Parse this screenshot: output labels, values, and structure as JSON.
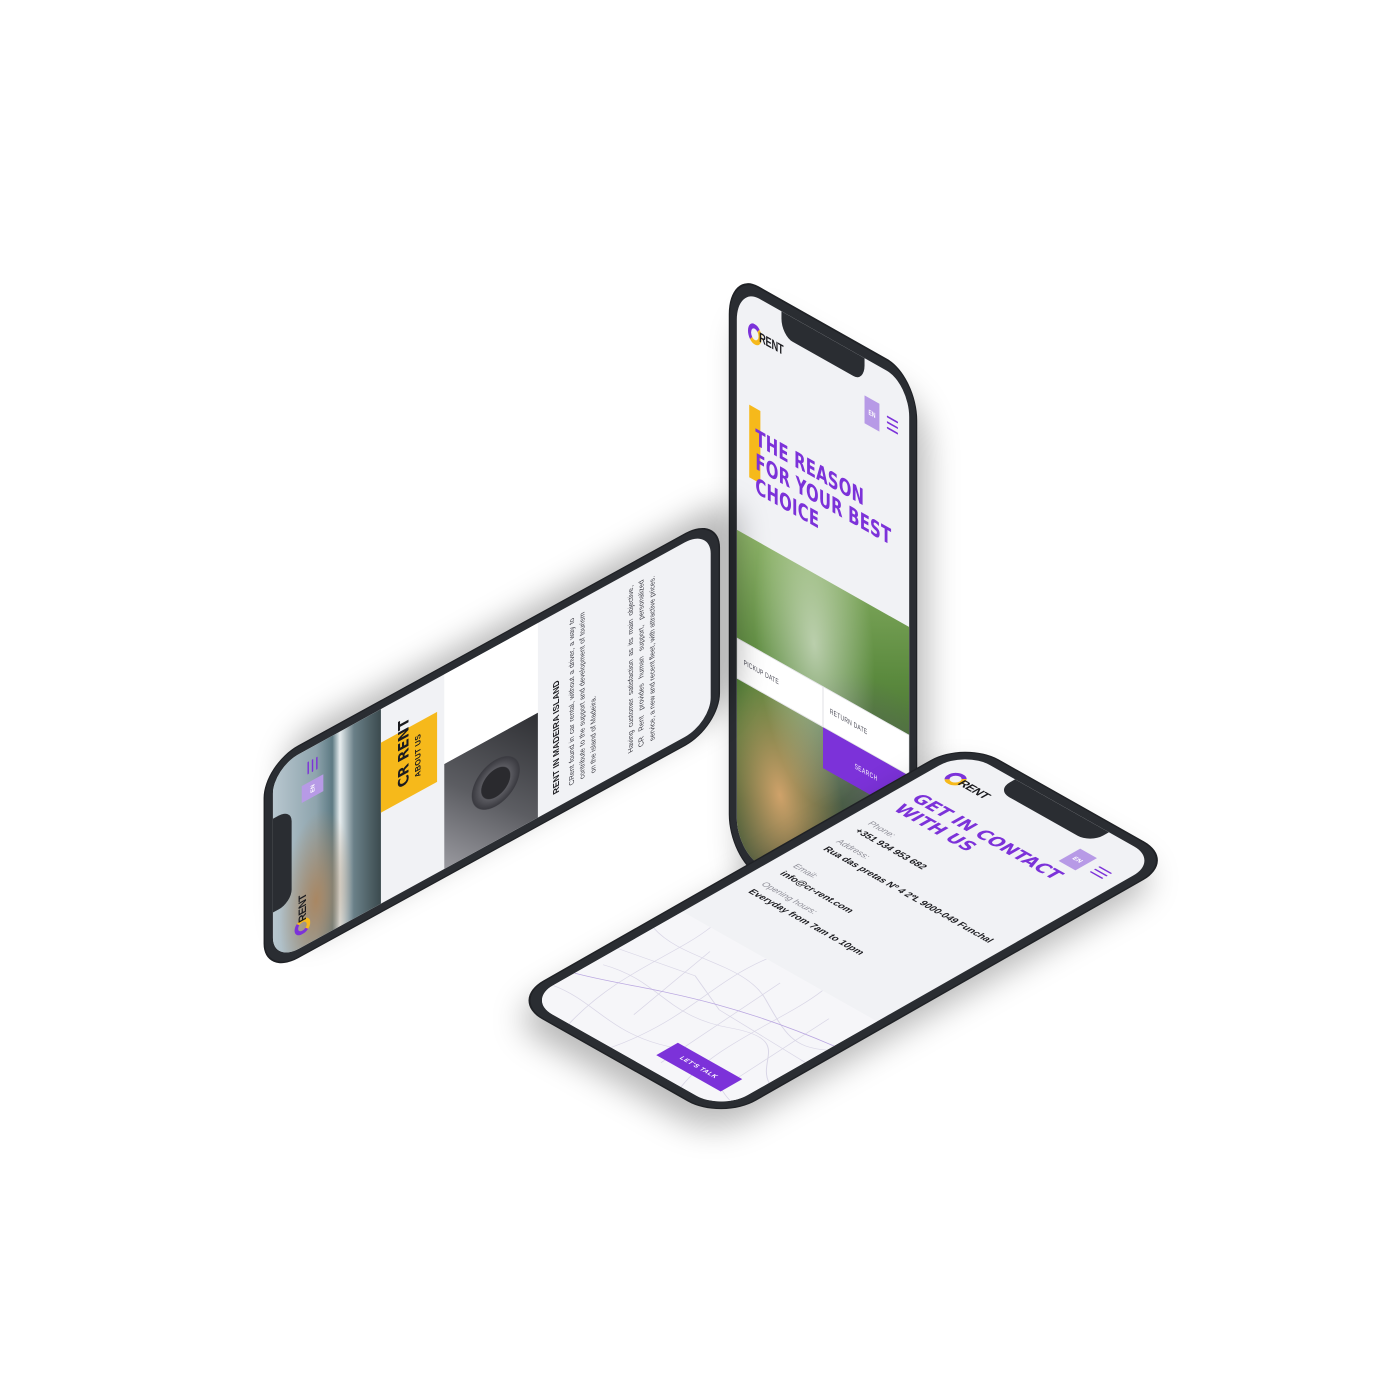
{
  "brand": {
    "logo_text": "RENT",
    "primary_color": "#7c32d9",
    "accent_color": "#f6b91b",
    "frame_color": "#2a2d32"
  },
  "header": {
    "language": "EN",
    "menu_icon": "hamburger-menu-icon"
  },
  "home": {
    "hero_title": "The reason for your best choice",
    "pickup_placeholder": "PICKUP DATE",
    "return_placeholder": "RETURN DATE",
    "search_label": "SEARCH"
  },
  "about": {
    "title": "CR RENT",
    "subtitle": "ABOUT US",
    "heading": "RENT IN MADEIRA ISLAND",
    "paragraph_1": "CRent found in car rental, without a driver, a way to contribute to the support and development of tourism on the island of Madeira.",
    "paragraph_2": "Having customer satisfaction as its main objective, CR Rent provides human support, personalized service, a new and recent fleet, with attractive prices."
  },
  "contact": {
    "title": "Get in contact with us",
    "phone_label": "Phone:",
    "phone_value": "+351 934 953 682",
    "address_label": "Address:",
    "address_value": "Rua das pretas Nº 4 2ºL 9000-049 Funchal",
    "email_label": "Email:",
    "email_value": "info@cr-rent.com",
    "hours_label": "Opening hours:",
    "hours_value": "Everyday from 7am to 10pm",
    "cta_label": "LET'S TALK"
  }
}
